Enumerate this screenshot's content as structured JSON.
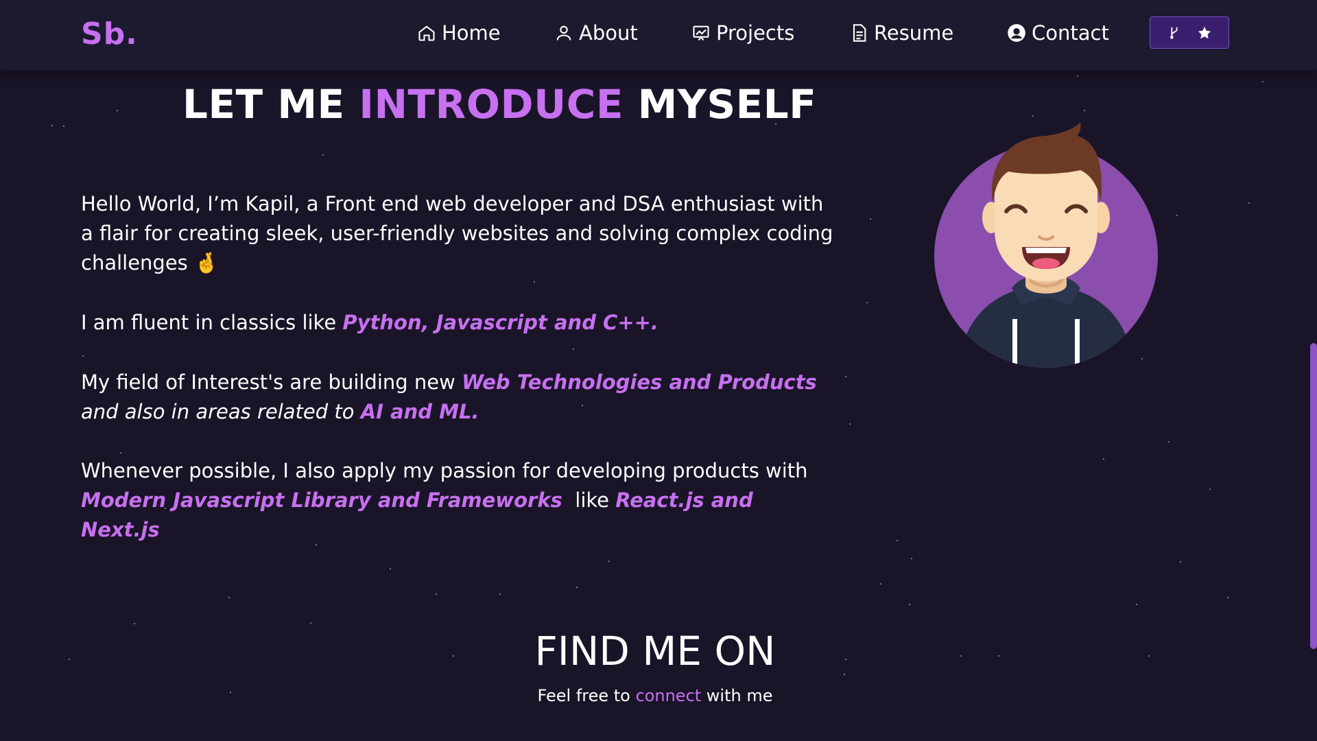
{
  "navbar": {
    "logo": "Sb.",
    "items": [
      {
        "label": "Home",
        "icon": "home-icon"
      },
      {
        "label": "About",
        "icon": "user-icon"
      },
      {
        "label": "Projects",
        "icon": "chart-icon"
      },
      {
        "label": "Resume",
        "icon": "document-icon"
      },
      {
        "label": "Contact",
        "icon": "user-circle-icon"
      }
    ],
    "repo_button": {
      "icons": [
        "fork-icon",
        "star-icon"
      ]
    }
  },
  "intro": {
    "title_part1": "LET ME ",
    "title_highlight": "INTRODUCE",
    "title_part2": " MYSELF",
    "p1": "Hello World, I’m Kapil, a Front end web developer and DSA enthusiast with a flair for creating sleek, user-friendly websites and solving complex coding challenges",
    "p1_emoji": "🤞",
    "p2_text": "I am fluent in classics like ",
    "p2_highlight": "Python, Javascript and C++.",
    "p3_text": "My field of Interest's are building new ",
    "p3_highlight1": "Web Technologies and Products",
    "p3_mid": " and also in areas related to ",
    "p3_highlight2": "AI and ML.",
    "p4_text": "Whenever possible, I also apply my passion for developing products with ",
    "p4_highlight1": "Modern Javascript Library and Frameworks",
    "p4_mid": "  like ",
    "p4_highlight2": "React.js and Next.js"
  },
  "find": {
    "title": "FIND ME ON",
    "sub_pre": "Feel free to ",
    "sub_link": "connect",
    "sub_post": " with me"
  },
  "colors": {
    "accent": "#c770f0",
    "background": "#1a1428",
    "navbar": "#1b1a2e"
  }
}
